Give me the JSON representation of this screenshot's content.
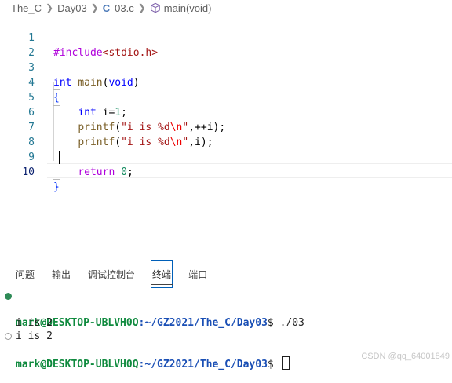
{
  "breadcrumb": {
    "items": [
      "The_C",
      "Day03",
      "03.c",
      "main(void)"
    ],
    "file_icon": "C",
    "symbol_icon": "cube-icon"
  },
  "editor": {
    "lines": [
      {
        "num": "1",
        "text": "#include<stdio.h>"
      },
      {
        "num": "2",
        "text": ""
      },
      {
        "num": "3",
        "text": "int main(void)"
      },
      {
        "num": "4",
        "text": "{"
      },
      {
        "num": "5",
        "text": "    int i=1;"
      },
      {
        "num": "6",
        "text": "    printf(\"i is %d\\n\",++i);"
      },
      {
        "num": "7",
        "text": "    printf(\"i is %d\\n\",i);"
      },
      {
        "num": "8",
        "text": ""
      },
      {
        "num": "9",
        "text": "    return 0;"
      },
      {
        "num": "10",
        "text": "}"
      }
    ],
    "active_line": "10"
  },
  "panel": {
    "tabs": [
      "问题",
      "输出",
      "调试控制台",
      "终端",
      "端口"
    ],
    "active_tab": "终端"
  },
  "terminal": {
    "prompt_user": "mark@DESKTOP-UBLVH0Q",
    "prompt_path": ":~/GZ2021/The_C/Day03",
    "command": "$ ./03",
    "output": [
      "i is 2",
      "i is 2"
    ],
    "prompt2_path": ":~/GZ2021/The_C/Day03",
    "prompt2_end": "$"
  },
  "watermark": "CSDN @qq_64001849",
  "colors": {
    "keyword": "#0000ff",
    "function": "#795e26",
    "string": "#a31515",
    "line_number": "#237893",
    "terminal_user": "#0f8a3e",
    "terminal_path": "#1a4fb5"
  }
}
